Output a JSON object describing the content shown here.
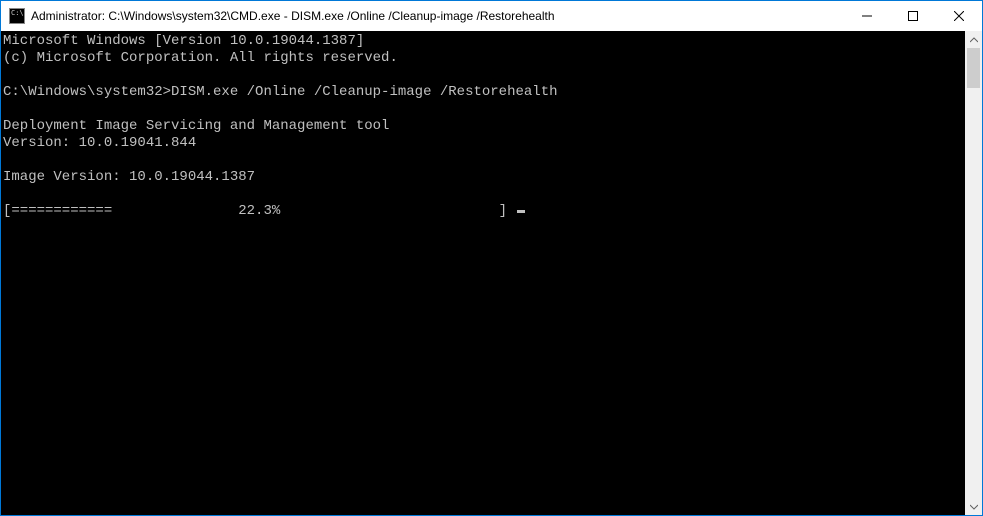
{
  "window": {
    "title": "Administrator: C:\\Windows\\system32\\CMD.exe - DISM.exe  /Online /Cleanup-image /Restorehealth"
  },
  "console": {
    "line1": "Microsoft Windows [Version 10.0.19044.1387]",
    "line2": "(c) Microsoft Corporation. All rights reserved.",
    "blank1": "",
    "prompt_line": "C:\\Windows\\system32>DISM.exe /Online /Cleanup-image /Restorehealth",
    "blank2": "",
    "tool_line": "Deployment Image Servicing and Management tool",
    "version_line": "Version: 10.0.19041.844",
    "blank3": "",
    "image_version_line": "Image Version: 10.0.19044.1387",
    "blank4": "",
    "progress_line": "[============               22.3%                          ] "
  }
}
